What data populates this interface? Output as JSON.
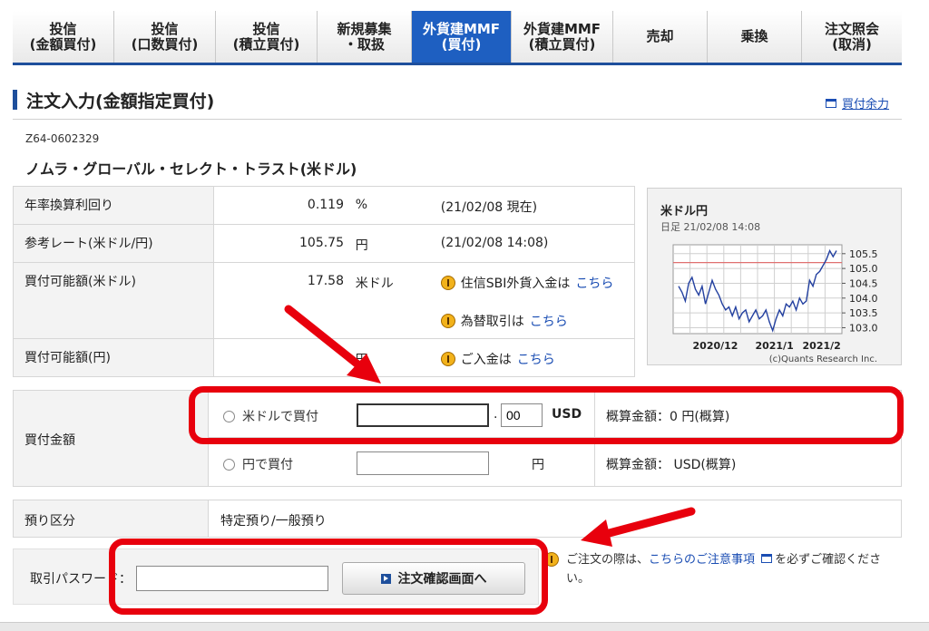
{
  "nav": {
    "tabs": [
      {
        "label": "投信\n(金額買付)",
        "active": false
      },
      {
        "label": "投信\n(口数買付)",
        "active": false
      },
      {
        "label": "投信\n(積立買付)",
        "active": false
      },
      {
        "label": "新規募集\n・取扱",
        "active": false
      },
      {
        "label": "外貨建MMF\n(買付)",
        "active": true
      },
      {
        "label": "外貨建MMF\n(積立買付)",
        "active": false
      },
      {
        "label": "売却",
        "active": false
      },
      {
        "label": "乗換",
        "active": false
      },
      {
        "label": "注文照会\n(取消)",
        "active": false
      }
    ]
  },
  "header": {
    "title": "注文入力(金額指定買付)",
    "capacity_link": "買付余力"
  },
  "fund": {
    "code": "Z64-0602329",
    "name": "ノムラ・グローバル・セレクト・トラスト(米ドル)"
  },
  "info": {
    "yield_label": "年率換算利回り",
    "yield_value": "0.119",
    "yield_unit": "%",
    "yield_note": "(21/02/08 現在)",
    "rate_label": "参考レート(米ドル/円)",
    "rate_value": "105.75",
    "rate_unit": "円",
    "rate_note": "(21/02/08 14:08)",
    "usd_cap_label": "買付可能額(米ドル)",
    "usd_cap_value": "17.58",
    "usd_cap_unit": "米ドル",
    "fx_deposit_text": "住信SBI外貨入金は",
    "fx_deposit_link": "こちら",
    "exchange_text": "為替取引は",
    "exchange_link": "こちら",
    "jpy_cap_label": "買付可能額(円)",
    "jpy_cap_unit": "円",
    "deposit_text": "ご入金は",
    "deposit_link": "こちら"
  },
  "mini_chart": {
    "title": "米ドル円",
    "subtitle": "日足 21/02/08 14:08",
    "credit": "(c)Quants Research Inc.",
    "chart_data": {
      "type": "line",
      "x_ticks": [
        "2020/12",
        "2021/1",
        "2021/2"
      ],
      "y_ticks": [
        "105.5",
        "105.0",
        "104.5",
        "104.0",
        "103.5",
        "103.0"
      ],
      "ylim": [
        102.8,
        105.8
      ],
      "reference_line": 105.2,
      "values": [
        104.4,
        104.2,
        103.9,
        104.5,
        104.7,
        104.3,
        104.1,
        104.4,
        103.8,
        104.2,
        104.6,
        104.3,
        104.1,
        103.8,
        103.6,
        103.7,
        103.4,
        103.7,
        103.3,
        103.5,
        103.6,
        103.2,
        103.4,
        103.6,
        103.3,
        103.4,
        103.6,
        103.2,
        102.9,
        103.3,
        103.6,
        103.4,
        103.8,
        103.7,
        103.9,
        103.6,
        104.0,
        103.8,
        103.9,
        104.6,
        104.4,
        104.8,
        104.9,
        105.1,
        105.3,
        105.6,
        105.4,
        105.6
      ],
      "line_color": "#2340a0",
      "reference_color": "#e07070"
    }
  },
  "amount": {
    "label": "買付金額",
    "usd_option": "米ドルで買付",
    "usd_value": "",
    "cents_value": "00",
    "usd_currency": "USD",
    "usd_estimate": "概算金額：0 円(概算)",
    "jpy_option": "円で買付",
    "jpy_value": "",
    "jpy_currency": "円",
    "jpy_estimate": "概算金額： USD(概算)"
  },
  "deposit": {
    "label": "預り区分",
    "value": "特定預り/一般預り"
  },
  "password": {
    "label": "取引パスワード：",
    "value": "",
    "confirm_button": "注文確認画面へ"
  },
  "caution": {
    "prefix": "ご注文の際は、",
    "link": "こちらのご注意事項",
    "suffix": "を必ずご確認ください。"
  },
  "colors": {
    "accent": "#1e4f9c",
    "active_tab": "#1e5fc1",
    "annotation": "#e8000d"
  }
}
